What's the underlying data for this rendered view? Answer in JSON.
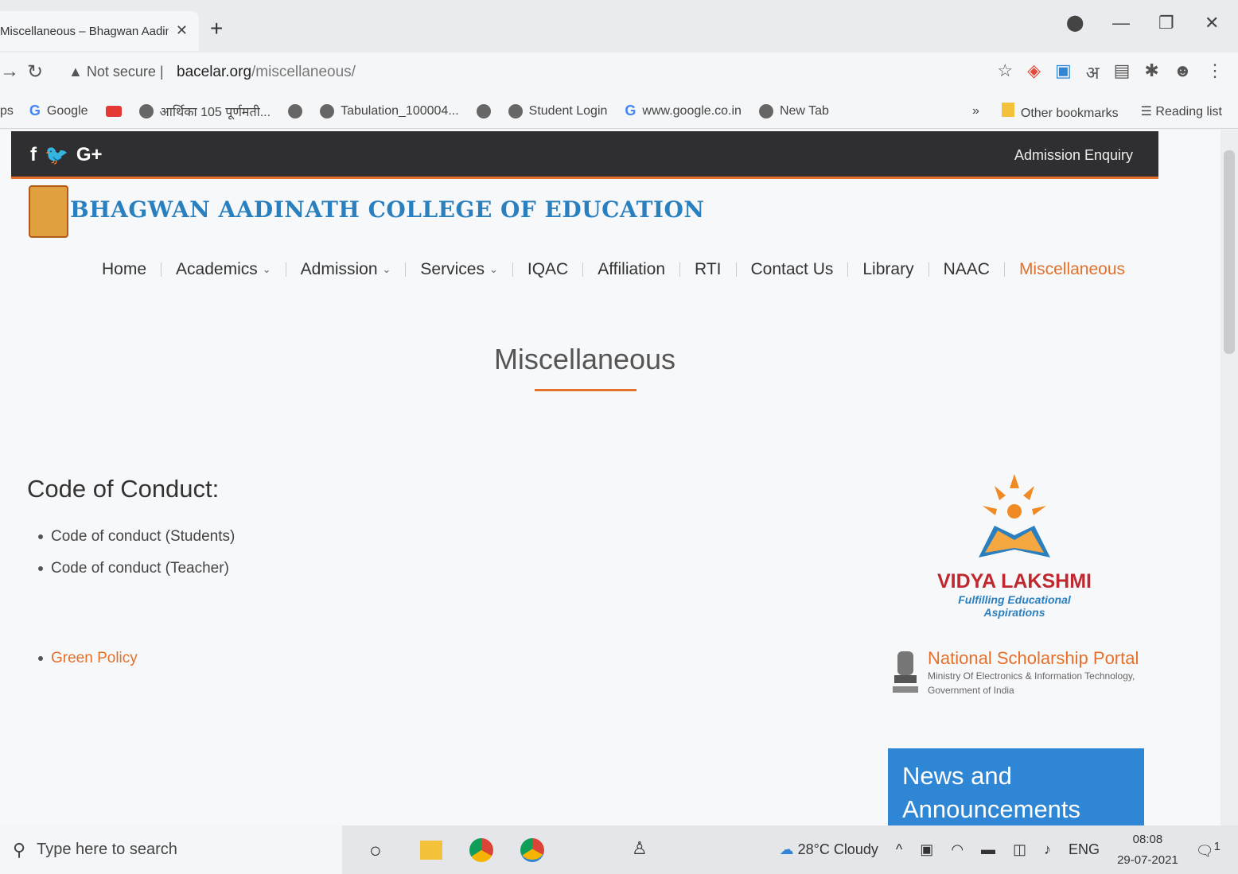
{
  "browser": {
    "tab_title": "Miscellaneous – Bhagwan Aadin",
    "url_host": "bacelar.org",
    "url_path": "/miscellaneous/",
    "security_label": "Not secure",
    "bookmarks": [
      {
        "label": "Google",
        "icon": "google-icon"
      },
      {
        "label": "",
        "icon": "youtube-icon"
      },
      {
        "label": "आर्थिका 105 पूर्णमती...",
        "icon": "globe-icon"
      },
      {
        "label": "",
        "icon": "globe-icon"
      },
      {
        "label": "Tabulation_100004...",
        "icon": "globe-icon"
      },
      {
        "label": "",
        "icon": "globe-icon"
      },
      {
        "label": "Student Login",
        "icon": "globe-icon"
      },
      {
        "label": "www.google.co.in",
        "icon": "google-icon"
      },
      {
        "label": "New Tab",
        "icon": "globe-icon"
      }
    ],
    "bookmarks_prefix": "ps",
    "overflow": "»",
    "other_bookmarks": "Other bookmarks",
    "reading_list": "Reading list"
  },
  "site": {
    "topbar": {
      "social": [
        "f",
        "🐦",
        "G+"
      ],
      "admission_enquiry": "Admission Enquiry"
    },
    "college_name": "BHAGWAN AADINATH COLLEGE OF EDUCATION",
    "nav": [
      {
        "label": "Home",
        "dropdown": false
      },
      {
        "label": "Academics",
        "dropdown": true
      },
      {
        "label": "Admission",
        "dropdown": true
      },
      {
        "label": "Services",
        "dropdown": true
      },
      {
        "label": "IQAC",
        "dropdown": false
      },
      {
        "label": "Affiliation",
        "dropdown": false
      },
      {
        "label": "RTI",
        "dropdown": false
      },
      {
        "label": "Contact Us",
        "dropdown": false
      },
      {
        "label": "Library",
        "dropdown": false
      },
      {
        "label": "NAAC",
        "dropdown": false
      },
      {
        "label": "Miscellaneous",
        "dropdown": false,
        "active": true
      }
    ],
    "page_title": "Miscellaneous",
    "section_heading": "Code of Conduct:",
    "conduct_items": [
      "Code of conduct (Students)",
      "Code of conduct (Teacher)"
    ],
    "green_policy": "Green Policy",
    "vidya": {
      "title": "VIDYA LAKSHMI",
      "subtitle": "Fulfilling Educational Aspirations"
    },
    "nsp": {
      "title": "National Scholarship Portal",
      "line1": "Ministry Of Electronics & Information Technology,",
      "line2": "Government of India"
    },
    "news_title": "News and Announcements"
  },
  "taskbar": {
    "search_placeholder": "Type here to search",
    "weather": "28°C  Cloudy",
    "lang": "ENG",
    "time": "08:08",
    "date": "29-07-2021",
    "notifications": "1"
  },
  "colors": {
    "accent": "#e5702a",
    "brand_blue": "#2a7fbf",
    "news_bg": "#2e86d4",
    "topbar": "#2f2f31"
  }
}
